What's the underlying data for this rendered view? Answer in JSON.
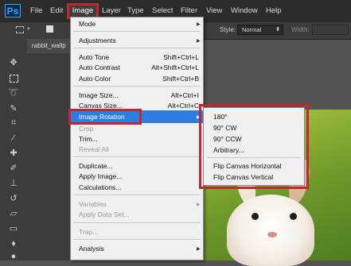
{
  "app": {
    "logo": "Ps"
  },
  "menubar": {
    "items": [
      "File",
      "Edit",
      "Image",
      "Layer",
      "Type",
      "Select",
      "Filter",
      "View",
      "Window",
      "Help"
    ]
  },
  "options_bar": {
    "style_label": "Style:",
    "style_value": "Normal",
    "width_label": "Width:"
  },
  "document": {
    "tab_label": "rabbit_wallp"
  },
  "image_menu": {
    "mode": "Mode",
    "adjustments": "Adjustments",
    "auto_tone": {
      "label": "Auto Tone",
      "shortcut": "Shift+Ctrl+L"
    },
    "auto_contrast": {
      "label": "Auto Contrast",
      "shortcut": "Alt+Shift+Ctrl+L"
    },
    "auto_color": {
      "label": "Auto Color",
      "shortcut": "Shift+Ctrl+B"
    },
    "image_size": {
      "label": "Image Size...",
      "shortcut": "Alt+Ctrl+I"
    },
    "canvas_size": {
      "label": "Canvas Size...",
      "shortcut": "Alt+Ctrl+C"
    },
    "image_rotation": "Image Rotation",
    "crop": "Crop",
    "trim": "Trim...",
    "reveal_all": "Reveal All",
    "duplicate": "Duplicate...",
    "apply_image": "Apply Image...",
    "calculations": "Calculations...",
    "variables": "Variables",
    "apply_data_set": "Apply Data Set...",
    "trap": "Trap...",
    "analysis": "Analysis"
  },
  "rotation_submenu": {
    "items": [
      "180°",
      "90° CW",
      "90° CCW",
      "Arbitrary...",
      "Flip Canvas Horizontal",
      "Flip Canvas Vertical"
    ]
  },
  "colors": {
    "highlight": "#2d7ee0",
    "callout": "#c1272d"
  }
}
